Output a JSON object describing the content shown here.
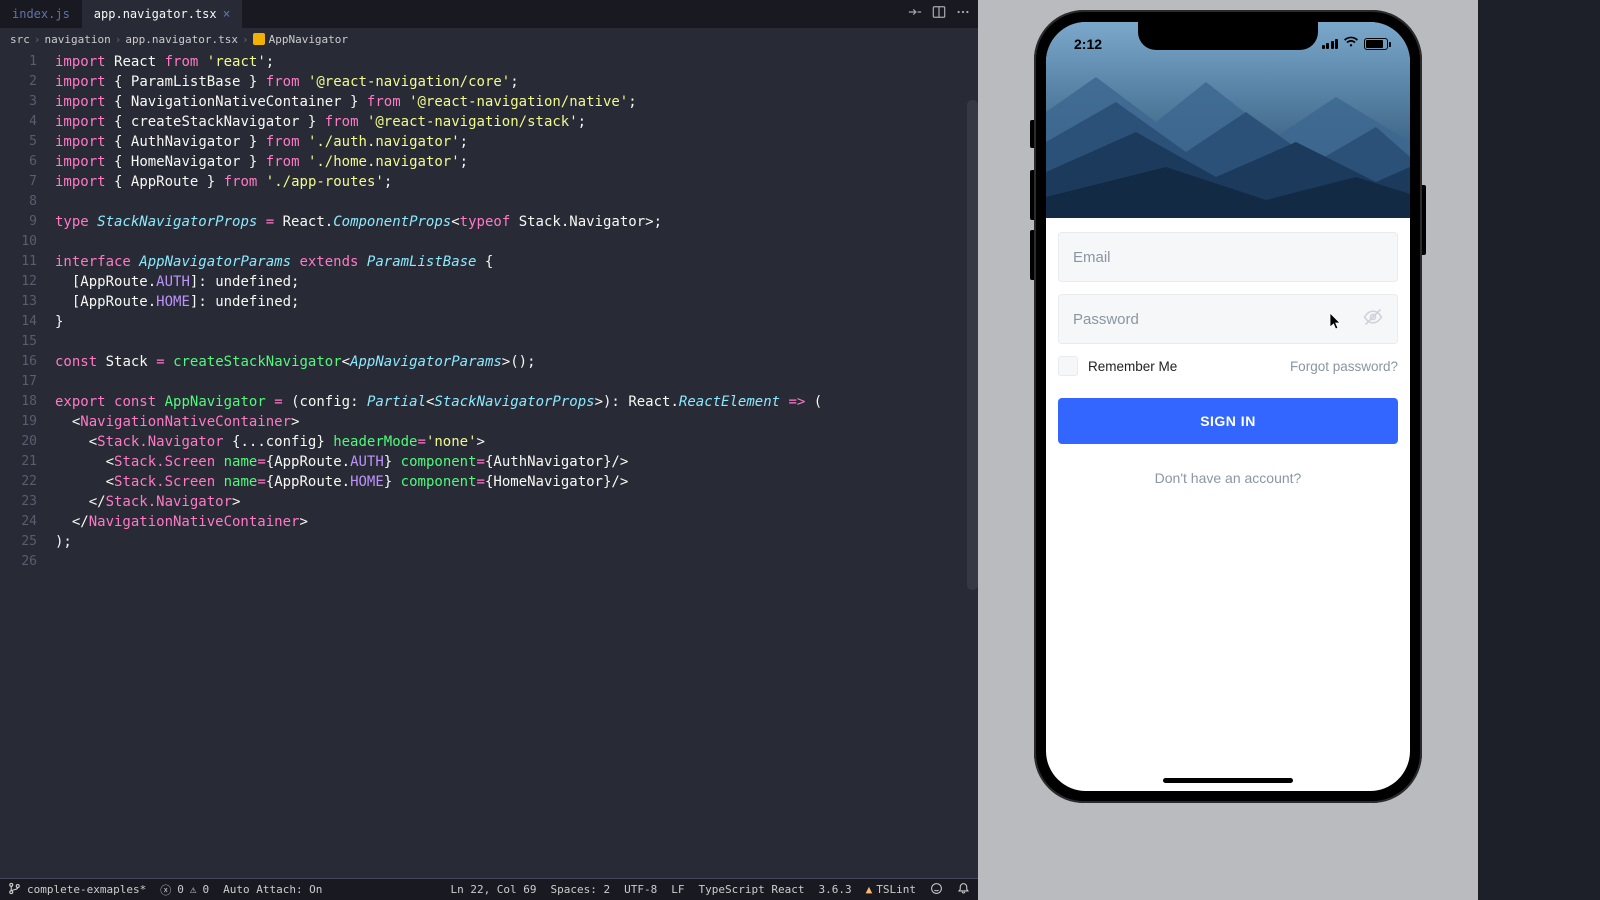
{
  "tabs": [
    {
      "label": "index.js",
      "active": false
    },
    {
      "label": "app.navigator.tsx",
      "active": true
    }
  ],
  "breadcrumb": {
    "path": [
      "src",
      "navigation",
      "app.navigator.tsx"
    ],
    "symbol": "AppNavigator"
  },
  "code_lines": [
    {
      "n": 1,
      "html": "<span class='kw'>import</span> <span class='id'>React</span> <span class='kw'>from</span> <span class='str'>'react'</span><span class='pn'>;</span>"
    },
    {
      "n": 2,
      "html": "<span class='kw'>import</span> <span class='pn'>{</span> <span class='id'>ParamListBase</span> <span class='pn'>}</span> <span class='kw'>from</span> <span class='str'>'@react-navigation/core'</span><span class='pn'>;</span>"
    },
    {
      "n": 3,
      "html": "<span class='kw'>import</span> <span class='pn'>{</span> <span class='id'>NavigationNativeContainer</span> <span class='pn'>}</span> <span class='kw'>from</span> <span class='str'>'@react-navigation/native'</span><span class='pn'>;</span>"
    },
    {
      "n": 4,
      "html": "<span class='kw'>import</span> <span class='pn'>{</span> <span class='id'>createStackNavigator</span> <span class='pn'>}</span> <span class='kw'>from</span> <span class='str'>'@react-navigation/stack'</span><span class='pn'>;</span>"
    },
    {
      "n": 5,
      "html": "<span class='kw'>import</span> <span class='pn'>{</span> <span class='id'>AuthNavigator</span> <span class='pn'>}</span> <span class='kw'>from</span> <span class='str'>'./auth.navigator'</span><span class='pn'>;</span>"
    },
    {
      "n": 6,
      "html": "<span class='kw'>import</span> <span class='pn'>{</span> <span class='id'>HomeNavigator</span> <span class='pn'>}</span> <span class='kw'>from</span> <span class='str'>'./home.navigator'</span><span class='pn'>;</span>"
    },
    {
      "n": 7,
      "html": "<span class='kw'>import</span> <span class='pn'>{</span> <span class='id'>AppRoute</span> <span class='pn'>}</span> <span class='kw'>from</span> <span class='str'>'./app-routes'</span><span class='pn'>;</span>"
    },
    {
      "n": 8,
      "html": ""
    },
    {
      "n": 9,
      "html": "<span class='kw'>type</span> <span class='type'>StackNavigatorProps</span> <span class='op'>=</span> <span class='id'>React</span><span class='pn'>.</span><span class='type'>ComponentProps</span><span class='pn'>&lt;</span><span class='kw'>typeof</span> <span class='id'>Stack</span><span class='pn'>.</span><span class='id'>Navigator</span><span class='pn'>&gt;;</span>"
    },
    {
      "n": 10,
      "html": ""
    },
    {
      "n": 11,
      "html": "<span class='kw'>interface</span> <span class='type'>AppNavigatorParams</span> <span class='kw'>extends</span> <span class='type'>ParamListBase</span> <span class='pn'>{</span>"
    },
    {
      "n": 12,
      "html": "  <span class='pn'>[</span><span class='id'>AppRoute</span><span class='pn'>.</span><span class='prop'>AUTH</span><span class='pn'>]:</span> <span class='id'>undefined</span><span class='pn'>;</span>"
    },
    {
      "n": 13,
      "html": "  <span class='pn'>[</span><span class='id'>AppRoute</span><span class='pn'>.</span><span class='prop'>HOME</span><span class='pn'>]:</span> <span class='id'>undefined</span><span class='pn'>;</span>"
    },
    {
      "n": 14,
      "html": "<span class='pn'>}</span>"
    },
    {
      "n": 15,
      "html": ""
    },
    {
      "n": 16,
      "html": "<span class='kw'>const</span> <span class='id'>Stack</span> <span class='op'>=</span> <span class='fn'>createStackNavigator</span><span class='pn'>&lt;</span><span class='type'>AppNavigatorParams</span><span class='pn'>&gt;();</span>"
    },
    {
      "n": 17,
      "html": ""
    },
    {
      "n": 18,
      "html": "<span class='kw'>export</span> <span class='kw'>const</span> <span class='fn'>AppNavigator</span> <span class='op'>=</span> <span class='pn'>(</span><span class='id'>config</span><span class='pn'>:</span> <span class='type'>Partial</span><span class='pn'>&lt;</span><span class='type'>StackNavigatorProps</span><span class='pn'>&gt;):</span> <span class='id'>React</span><span class='pn'>.</span><span class='type'>ReactElement</span> <span class='op'>=&gt;</span> <span class='pn'>(</span>"
    },
    {
      "n": 19,
      "html": "  <span class='pn'>&lt;</span><span class='tgn'>NavigationNativeContainer</span><span class='pn'>&gt;</span>"
    },
    {
      "n": 20,
      "html": "    <span class='pn'>&lt;</span><span class='tgn'>Stack.Navigator</span> <span class='pn'>{...</span><span class='id'>config</span><span class='pn'>}</span> <span class='at'>headerMode</span><span class='op'>=</span><span class='str'>'none'</span><span class='pn'>&gt;</span>"
    },
    {
      "n": 21,
      "html": "      <span class='pn'>&lt;</span><span class='tgn'>Stack.Screen</span> <span class='at'>name</span><span class='op'>=</span><span class='pn'>{</span><span class='id'>AppRoute</span><span class='pn'>.</span><span class='prop'>AUTH</span><span class='pn'>}</span> <span class='at'>component</span><span class='op'>=</span><span class='pn'>{</span><span class='id'>AuthNavigator</span><span class='pn'>}/&gt;</span>"
    },
    {
      "n": 22,
      "html": "      <span class='pn'>&lt;</span><span class='tgn'>Stack.Screen</span> <span class='at'>name</span><span class='op'>=</span><span class='pn'>{</span><span class='id'>AppRoute</span><span class='pn'>.</span><span class='prop'>HOME</span><span class='pn'>}</span> <span class='at'>component</span><span class='op'>=</span><span class='pn'>{</span><span class='id'>HomeNavigator</span><span class='pn'>}/&gt;</span>"
    },
    {
      "n": 23,
      "html": "    <span class='pn'>&lt;/</span><span class='tgn'>Stack.Navigator</span><span class='pn'>&gt;</span>"
    },
    {
      "n": 24,
      "html": "  <span class='pn'>&lt;/</span><span class='tgn'>NavigationNativeContainer</span><span class='pn'>&gt;</span>"
    },
    {
      "n": 25,
      "html": "<span class='pn'>);</span>"
    },
    {
      "n": 26,
      "html": ""
    }
  ],
  "statusbar": {
    "branch": "complete-exmaples*",
    "errors": "0",
    "warnings": "0",
    "auto_attach": "Auto Attach: On",
    "position": "Ln 22, Col 69",
    "spaces": "Spaces: 2",
    "encoding": "UTF-8",
    "eol": "LF",
    "lang": "TypeScript React",
    "ts_version": "3.6.3",
    "tslint": "TSLint"
  },
  "simulator": {
    "time": "2:12",
    "email_placeholder": "Email",
    "password_placeholder": "Password",
    "remember": "Remember Me",
    "forgot": "Forgot password?",
    "signin": "SIGN IN",
    "noaccount": "Don't have an account?"
  }
}
